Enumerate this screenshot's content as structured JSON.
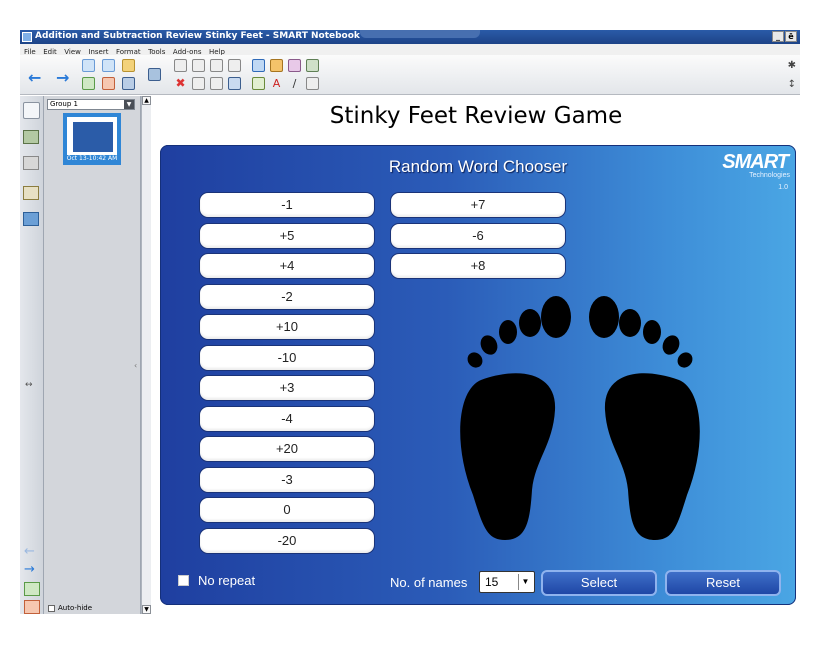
{
  "window": {
    "title": "Addition and Subtraction Review Stinky Feet - SMART Notebook",
    "controls": [
      "_",
      "ē",
      ""
    ]
  },
  "menu": [
    "File",
    "Edit",
    "View",
    "Insert",
    "Format",
    "Tools",
    "Add-ons",
    "Help"
  ],
  "sorter": {
    "group": "Group 1",
    "thumbnail_label": "Oct 13-10:42 AM",
    "autohide_label": "Auto-hide"
  },
  "page": {
    "title": "Stinky Feet Review Game"
  },
  "chooser": {
    "title": "Random Word Chooser",
    "brand": "SMART",
    "brand_sub": "Technologies",
    "version": "1.0",
    "words_col1": [
      "-1",
      "+5",
      "+4",
      "-2",
      "+10",
      "-10",
      "+3",
      "-4",
      "+20",
      "-3",
      "0",
      "-20"
    ],
    "words_col2": [
      "+7",
      "-6",
      "+8"
    ],
    "no_repeat_label": "No repeat",
    "names_label": "No. of names",
    "names_value": "15",
    "select_label": "Select",
    "reset_label": "Reset"
  },
  "colors": {
    "panel_start": "#1f3fa0",
    "panel_end": "#4aa6e4",
    "titlebar": "#2a5ba8"
  }
}
